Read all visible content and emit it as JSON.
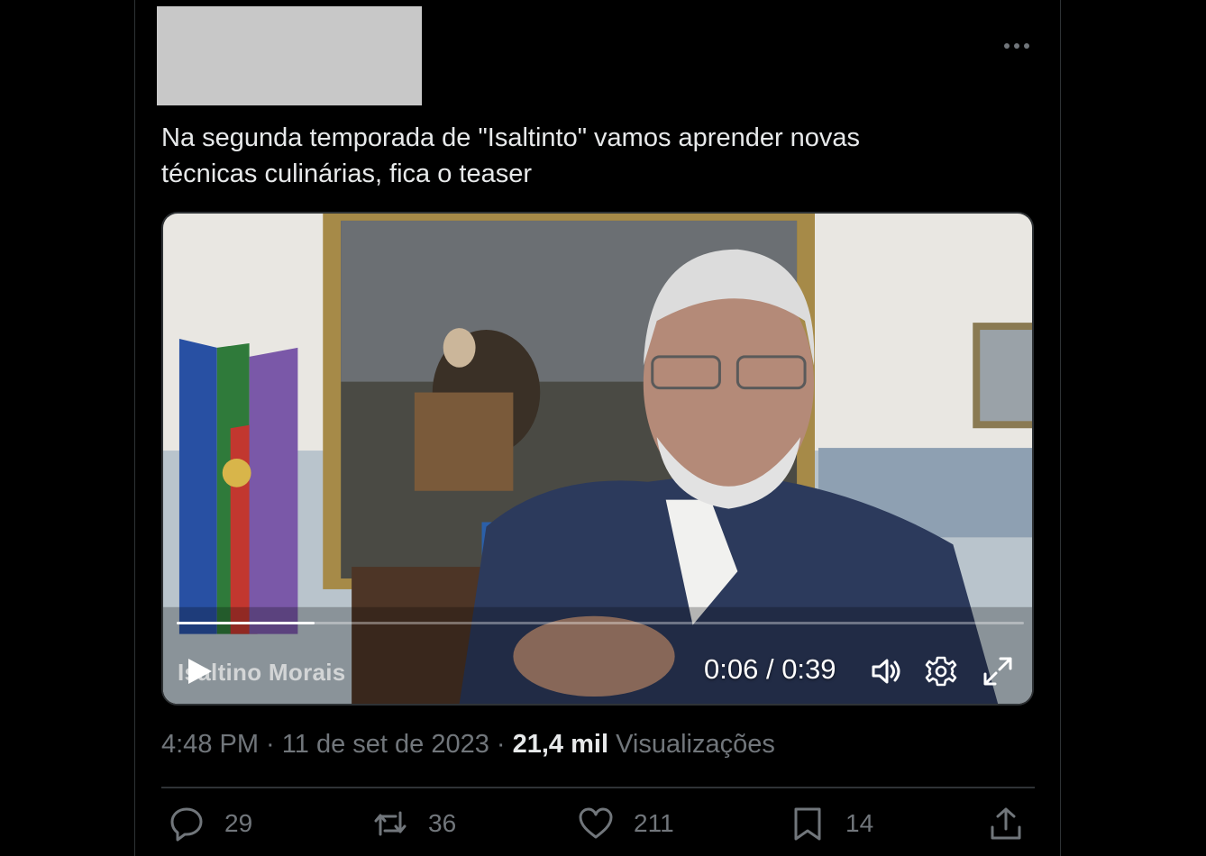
{
  "tweet": {
    "text": "Na segunda temporada de \"Isaltinto\" vamos aprender novas\ntécnicas culinárias, fica o teaser",
    "more_icon": "more-horizontal-icon"
  },
  "video": {
    "watermark": "Isaltino Morais",
    "current_time": "0:06",
    "separator": " / ",
    "duration": "0:39",
    "progress": 0.163,
    "icons": {
      "play": "play-icon",
      "volume": "volume-icon",
      "settings": "gear-icon",
      "fullscreen": "expand-icon"
    }
  },
  "meta": {
    "time": "4:48 PM",
    "dot": " · ",
    "date": "11 de set de 2023",
    "views_count": "21,4 mil",
    "views_label": "Visualizações"
  },
  "actions": {
    "replies": "29",
    "retweets": "36",
    "likes": "211",
    "bookmarks": "14"
  },
  "colors": {
    "background": "#000000",
    "text": "#e7e9ea",
    "muted": "#71767b",
    "border": "#2f3336"
  }
}
